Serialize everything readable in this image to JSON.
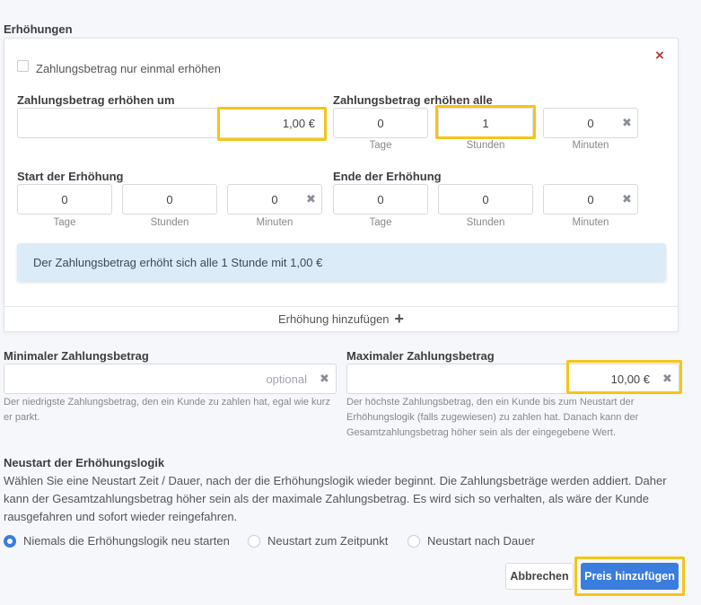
{
  "increases": {
    "title": "Erhöhungen",
    "once_checkbox_label": "Zahlungsbetrag nur einmal erhöhen",
    "increase_by": {
      "label": "Zahlungsbetrag erhöhen um",
      "value": "1,00 €"
    },
    "increase_every": {
      "label": "Zahlungsbetrag erhöhen alle",
      "days": "0",
      "hours": "1",
      "minutes": "0"
    },
    "start": {
      "label": "Start der Erhöhung",
      "days": "0",
      "hours": "0",
      "minutes": "0"
    },
    "end": {
      "label": "Ende der Erhöhung",
      "days": "0",
      "hours": "0",
      "minutes": "0"
    },
    "units": {
      "days": "Tage",
      "hours": "Stunden",
      "minutes": "Minuten"
    },
    "info": "Der Zahlungsbetrag erhöht sich alle 1 Stunde mit 1,00 €",
    "add_label": "Erhöhung hinzufügen",
    "close_icon": "×",
    "clear_icon": "✖"
  },
  "min_amount": {
    "label": "Minimaler Zahlungsbetrag",
    "placeholder": "optional",
    "help": "Der niedrigste Zahlungsbetrag, den ein Kunde zu zahlen hat, egal wie kurz er parkt."
  },
  "max_amount": {
    "label": "Maximaler Zahlungsbetrag",
    "value": "10,00 €",
    "help": "Der höchste Zahlungsbetrag, den ein Kunde bis zum Neustart der Erhöhungslogik (falls zugewiesen) zu zahlen hat. Danach kann der Gesamtzahlungsbetrag höher sein als der eingegebene Wert."
  },
  "restart": {
    "title": "Neustart der Erhöhungslogik",
    "description": "Wählen Sie eine Neustart Zeit / Dauer, nach der die Erhöhungslogik wieder beginnt. Die Zahlungsbeträge werden addiert. Daher kann der Gesamtzahlungsbetrag höher sein als der maximale Zahlungsbetrag. Es wird sich so verhalten, als wäre der Kunde rausgefahren und sofort wieder reingefahren.",
    "options": [
      {
        "label": "Niemals die Erhöhungslogik neu starten",
        "selected": true
      },
      {
        "label": "Neustart zum Zeitpunkt",
        "selected": false
      },
      {
        "label": "Neustart nach Dauer",
        "selected": false
      }
    ]
  },
  "actions": {
    "cancel": "Abbrechen",
    "submit": "Preis hinzufügen"
  },
  "colors": {
    "primary": "#3b7ddd",
    "highlight": "#f5c518",
    "info_bg": "#dcebf8",
    "close": "#b23b3b"
  }
}
